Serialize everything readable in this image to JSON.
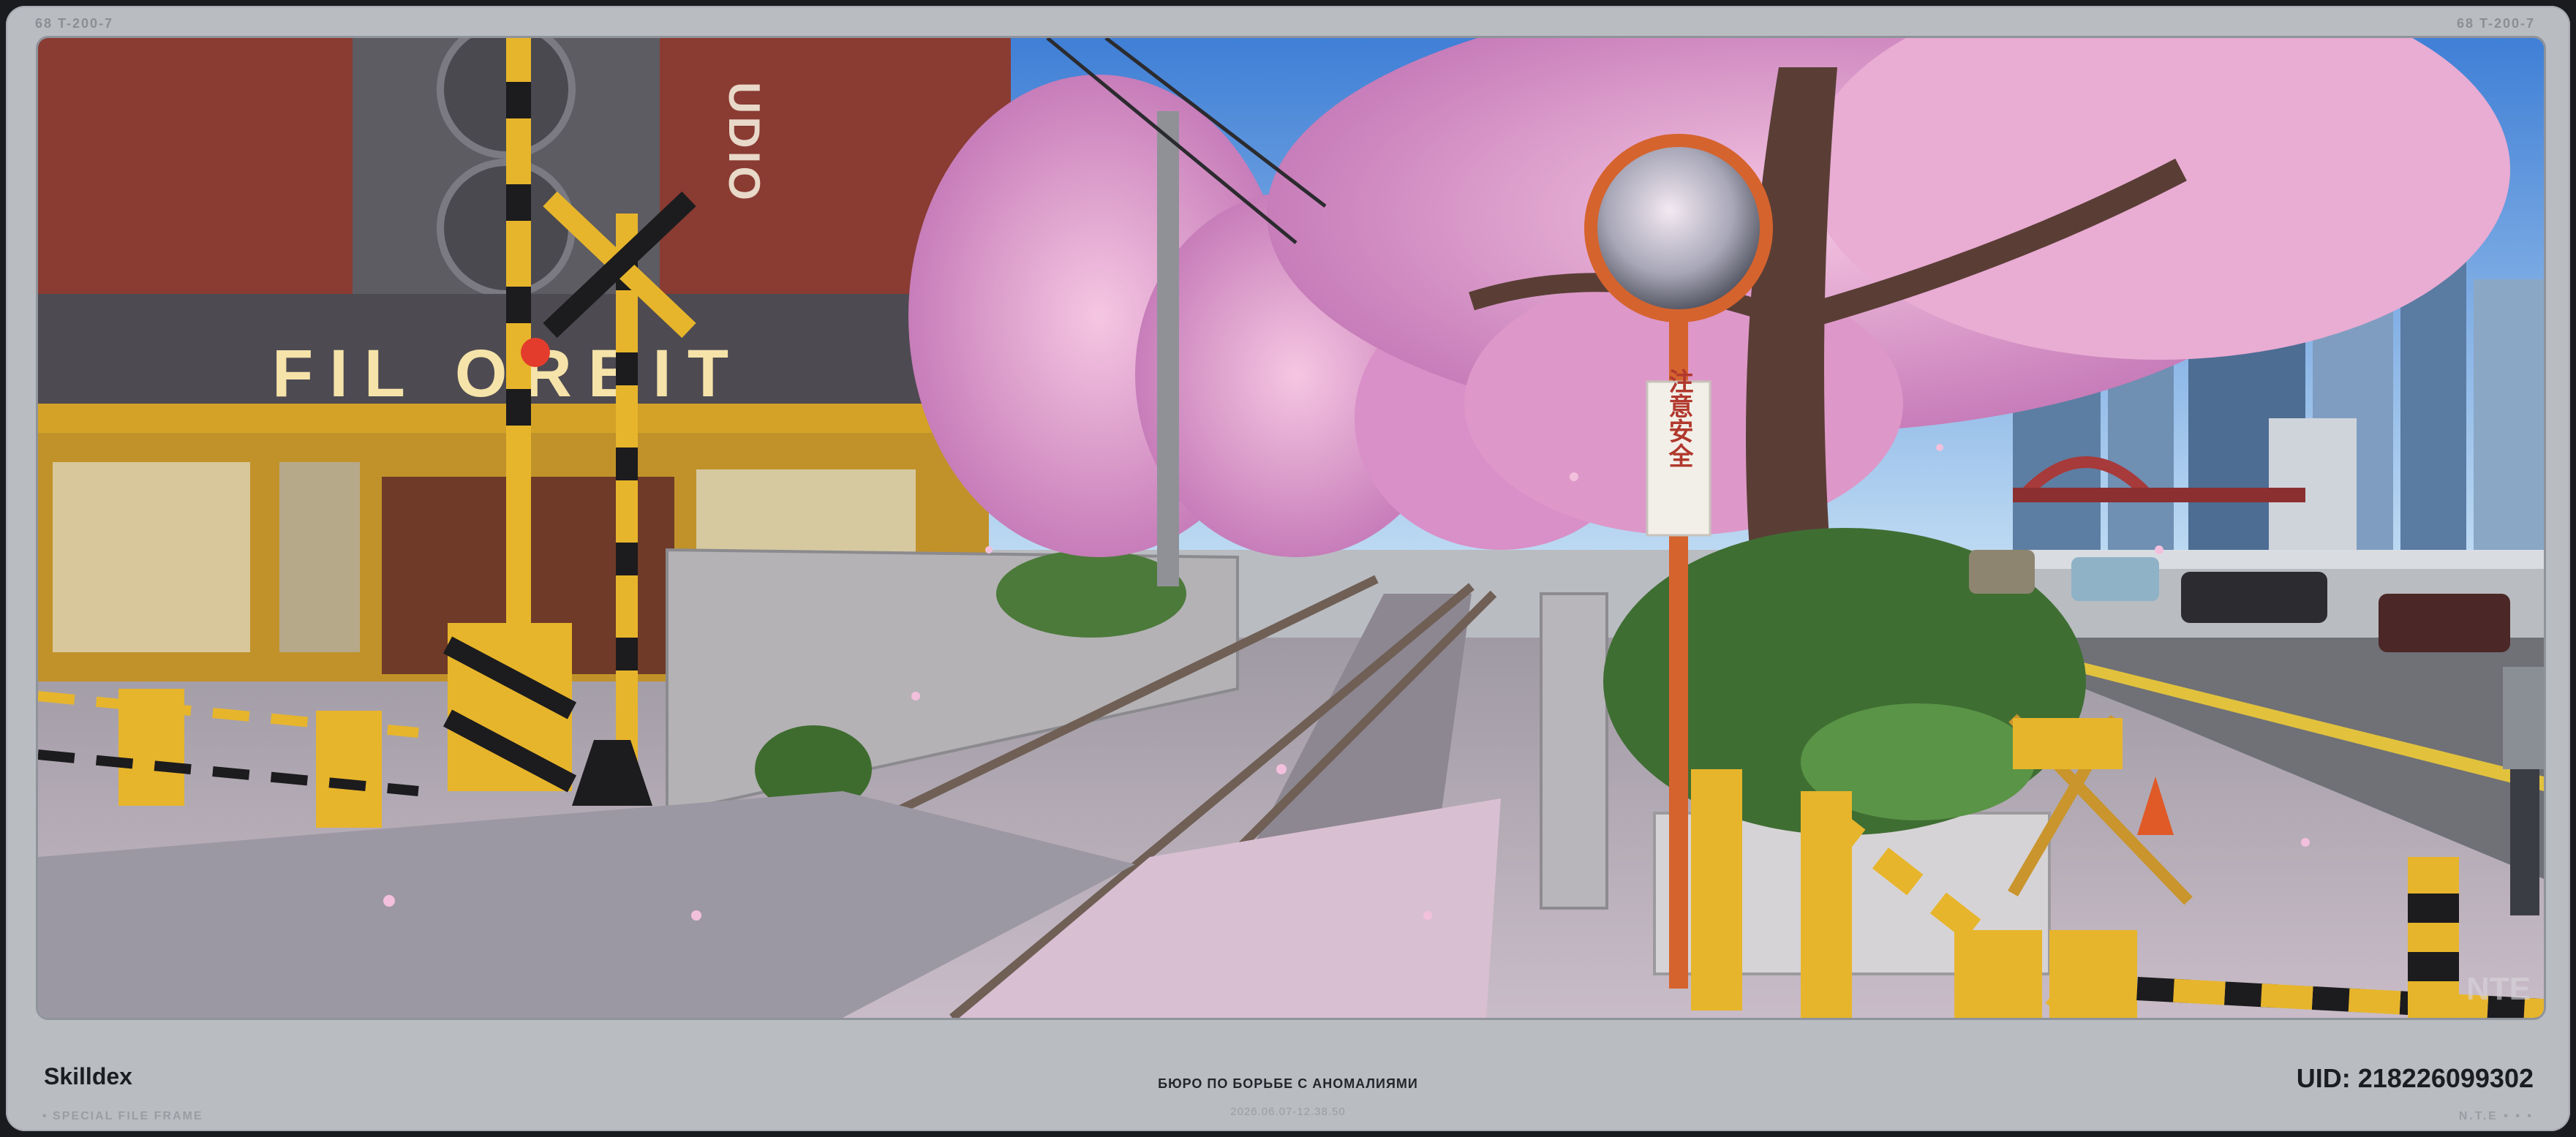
{
  "corner_label": "68 T-200-7",
  "footer": {
    "title": "Skilldex",
    "subtitle": "• SPECIAL FILE FRAME",
    "center_title": "БЮРО ПО БОРЬБЕ С АНОМАЛИЯМИ",
    "timestamp": "2026.06.07-12.38.50",
    "uid": "UID: 21822609930​2",
    "brand": "N.T.E • • •"
  },
  "scene": {
    "storefront_sign": "FIL ORBIT",
    "studio_sign": "UDIO",
    "pole_sign": "注意安全",
    "watermark": "NTE",
    "colors": {
      "sky": "#7fb6e8",
      "blossom": "#e7a7cf",
      "blossom_dark": "#b76aa7",
      "brick": "#8a3b32",
      "stone": "#b4b2b5",
      "hazard_yellow": "#e7b52b",
      "hazard_black": "#1c1c1e"
    }
  }
}
